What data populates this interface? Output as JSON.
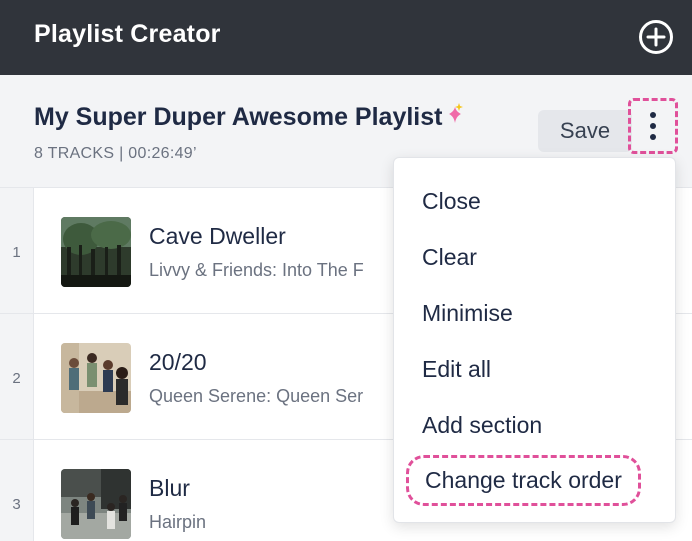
{
  "app": {
    "title": "Playlist Creator",
    "add_icon": "plus-circle-icon"
  },
  "playlist": {
    "title": "My Super Duper Awesome Playlist",
    "title_icon": "sparkle-icon",
    "meta": "8 TRACKS | 00:26:49’",
    "save_label": "Save",
    "more_icon": "more-vertical-icon"
  },
  "tracks": [
    {
      "number": "1",
      "title": "Cave Dweller",
      "subtitle": "Livvy & Friends: Into The F"
    },
    {
      "number": "2",
      "title": "20/20",
      "subtitle": "Queen Serene: Queen Ser"
    },
    {
      "number": "3",
      "title": "Blur",
      "subtitle": "Hairpin"
    }
  ],
  "menu": {
    "items": [
      "Close",
      "Clear",
      "Minimise",
      "Edit all",
      "Add section",
      "Change track order"
    ]
  },
  "colors": {
    "topbar": "#30343b",
    "highlight": "#e0509a",
    "text": "#1f2a44",
    "muted": "#6b7280"
  }
}
